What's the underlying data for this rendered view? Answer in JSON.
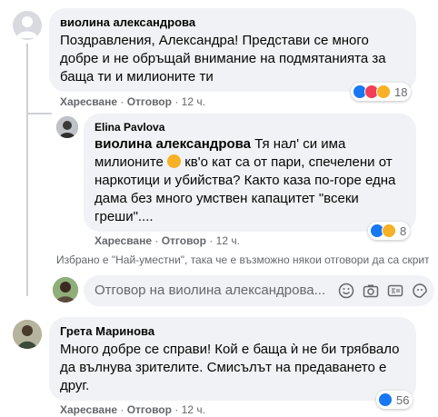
{
  "comments": [
    {
      "author": "виолина александрова",
      "lines": [
        "Поздравления, Александра! Представи се много",
        "добре и не обръщай внимание на подмятанията за",
        "баща ти и милионите ти"
      ],
      "like_label": "Харесване",
      "reply_label": "Отговор",
      "time": "12 ч.",
      "reaction_count": "18"
    }
  ],
  "reply": {
    "author": "Elina Pavlova",
    "mention": "виолина александрова",
    "line1_rest": " Тя нал' си има",
    "line2_pre": "милионите ",
    "line2_post": " кв'о кат са от пари, спечелени от",
    "line3": "наркотици и убийства? Както каза по-горе една",
    "line4": "дама без много умствен капацитет \"всеки",
    "line5": "греши\"....",
    "like_label": "Харесване",
    "reply_label": "Отговор",
    "time": "12 ч.",
    "reaction_count": "8"
  },
  "filter_note": "Избрано е \"Най-уместни\", така че е възможно някои отговори да са скрити",
  "reply_input": {
    "placeholder": "Отговор на виолина александрова..."
  },
  "comment2": {
    "author": "Грета Маринова",
    "lines": [
      "Много добре се справи! Кой е баща ѝ не би трябвало",
      "да вълнува зрителите. Смисълът на предаването е",
      "друг."
    ],
    "like_label": "Харесване",
    "reply_label": "Отговор",
    "time": "12 ч.",
    "reaction_count": "56"
  },
  "colors": {
    "bubble": "#f0f2f5",
    "meta": "#65676b",
    "like_blue": "#1877f2",
    "love_red": "#f33e58",
    "haha_yellow": "#f7b125"
  }
}
